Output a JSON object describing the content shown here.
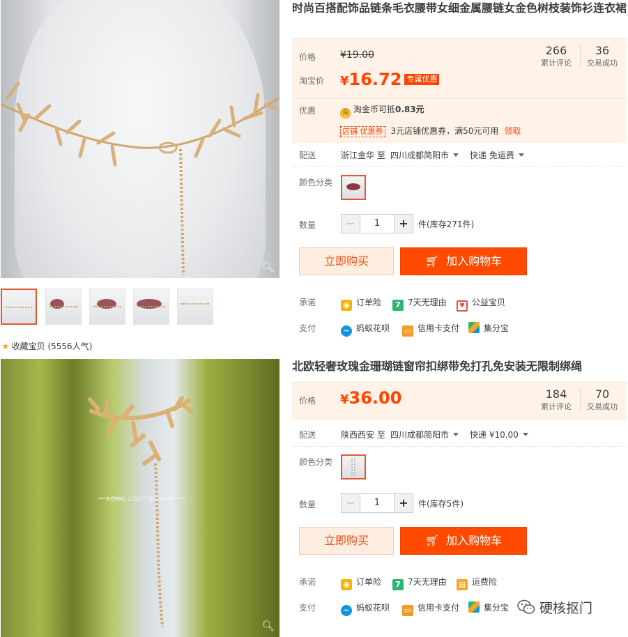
{
  "product1": {
    "title": "时尚百搭配饰品链条毛衣腰带女细金属腰链女金色树枝装饰衫连衣裙",
    "price_label": "价格",
    "original_price": "¥19.00",
    "promo_label": "淘宝价",
    "currency": "¥",
    "promo_price": "16.72",
    "promo_tag": "专属优惠",
    "reviews_count": "266",
    "reviews_caption": "累计评论",
    "trades_count": "36",
    "trades_caption": "交易成功",
    "discount_label": "优惠",
    "coin_icon_text": "淘",
    "coin_text_prefix": "淘金币可抵",
    "coin_amount": "0.83元",
    "coupon_tag": "店铺 优惠券",
    "coupon_text": "3元店铺优惠券，满50元可用",
    "coupon_claim": "领取",
    "shipping_label": "配送",
    "ship_from": "浙江金华 至",
    "ship_to": "四川成都简阳市",
    "ship_method": "快递 免运费",
    "color_label": "颜色分类",
    "qty_label": "数量",
    "qty_value": "1",
    "stock": "件(库存271件)",
    "buy_now": "立即购买",
    "add_cart": "加入购物车",
    "promise_label": "承诺",
    "promises": [
      "订单险",
      "7天无理由",
      "公益宝贝"
    ],
    "pay_label": "支付",
    "payments": [
      "蚂蚁花呗",
      "信用卡支付",
      "集分宝"
    ],
    "collect_text": "收藏宝贝 (5556人气)"
  },
  "product2": {
    "title": "北欧轻奢玫瑰金珊瑚链窗帘扣绑带免打孔免安装无限制绑绳",
    "price_label": "价格",
    "currency": "¥",
    "price": "36.00",
    "reviews_count": "184",
    "reviews_caption": "累计评论",
    "trades_count": "70",
    "trades_caption": "交易成功",
    "shipping_label": "配送",
    "ship_from": "陕西西安 至",
    "ship_to": "四川成都简阳市",
    "ship_method": "快递 ¥10.00",
    "color_label": "颜色分类",
    "qty_label": "数量",
    "qty_value": "1",
    "stock": "件(库存5件)",
    "buy_now": "立即购买",
    "add_cart": "加入购物车",
    "promise_label": "承诺",
    "promises": [
      "订单险",
      "7天无理由",
      "运费险"
    ],
    "pay_label": "支付",
    "payments": [
      "蚂蚁花呗",
      "信用卡支付",
      "集分宝"
    ],
    "image_watermark": "LONG LOST WORLD"
  },
  "watermark": "硬核抠门",
  "colors": {
    "accent": "#ff4400",
    "price_bg": "#fff2e8",
    "buy_bg": "#ffeee0",
    "cart_bg": "#ff4a00"
  }
}
